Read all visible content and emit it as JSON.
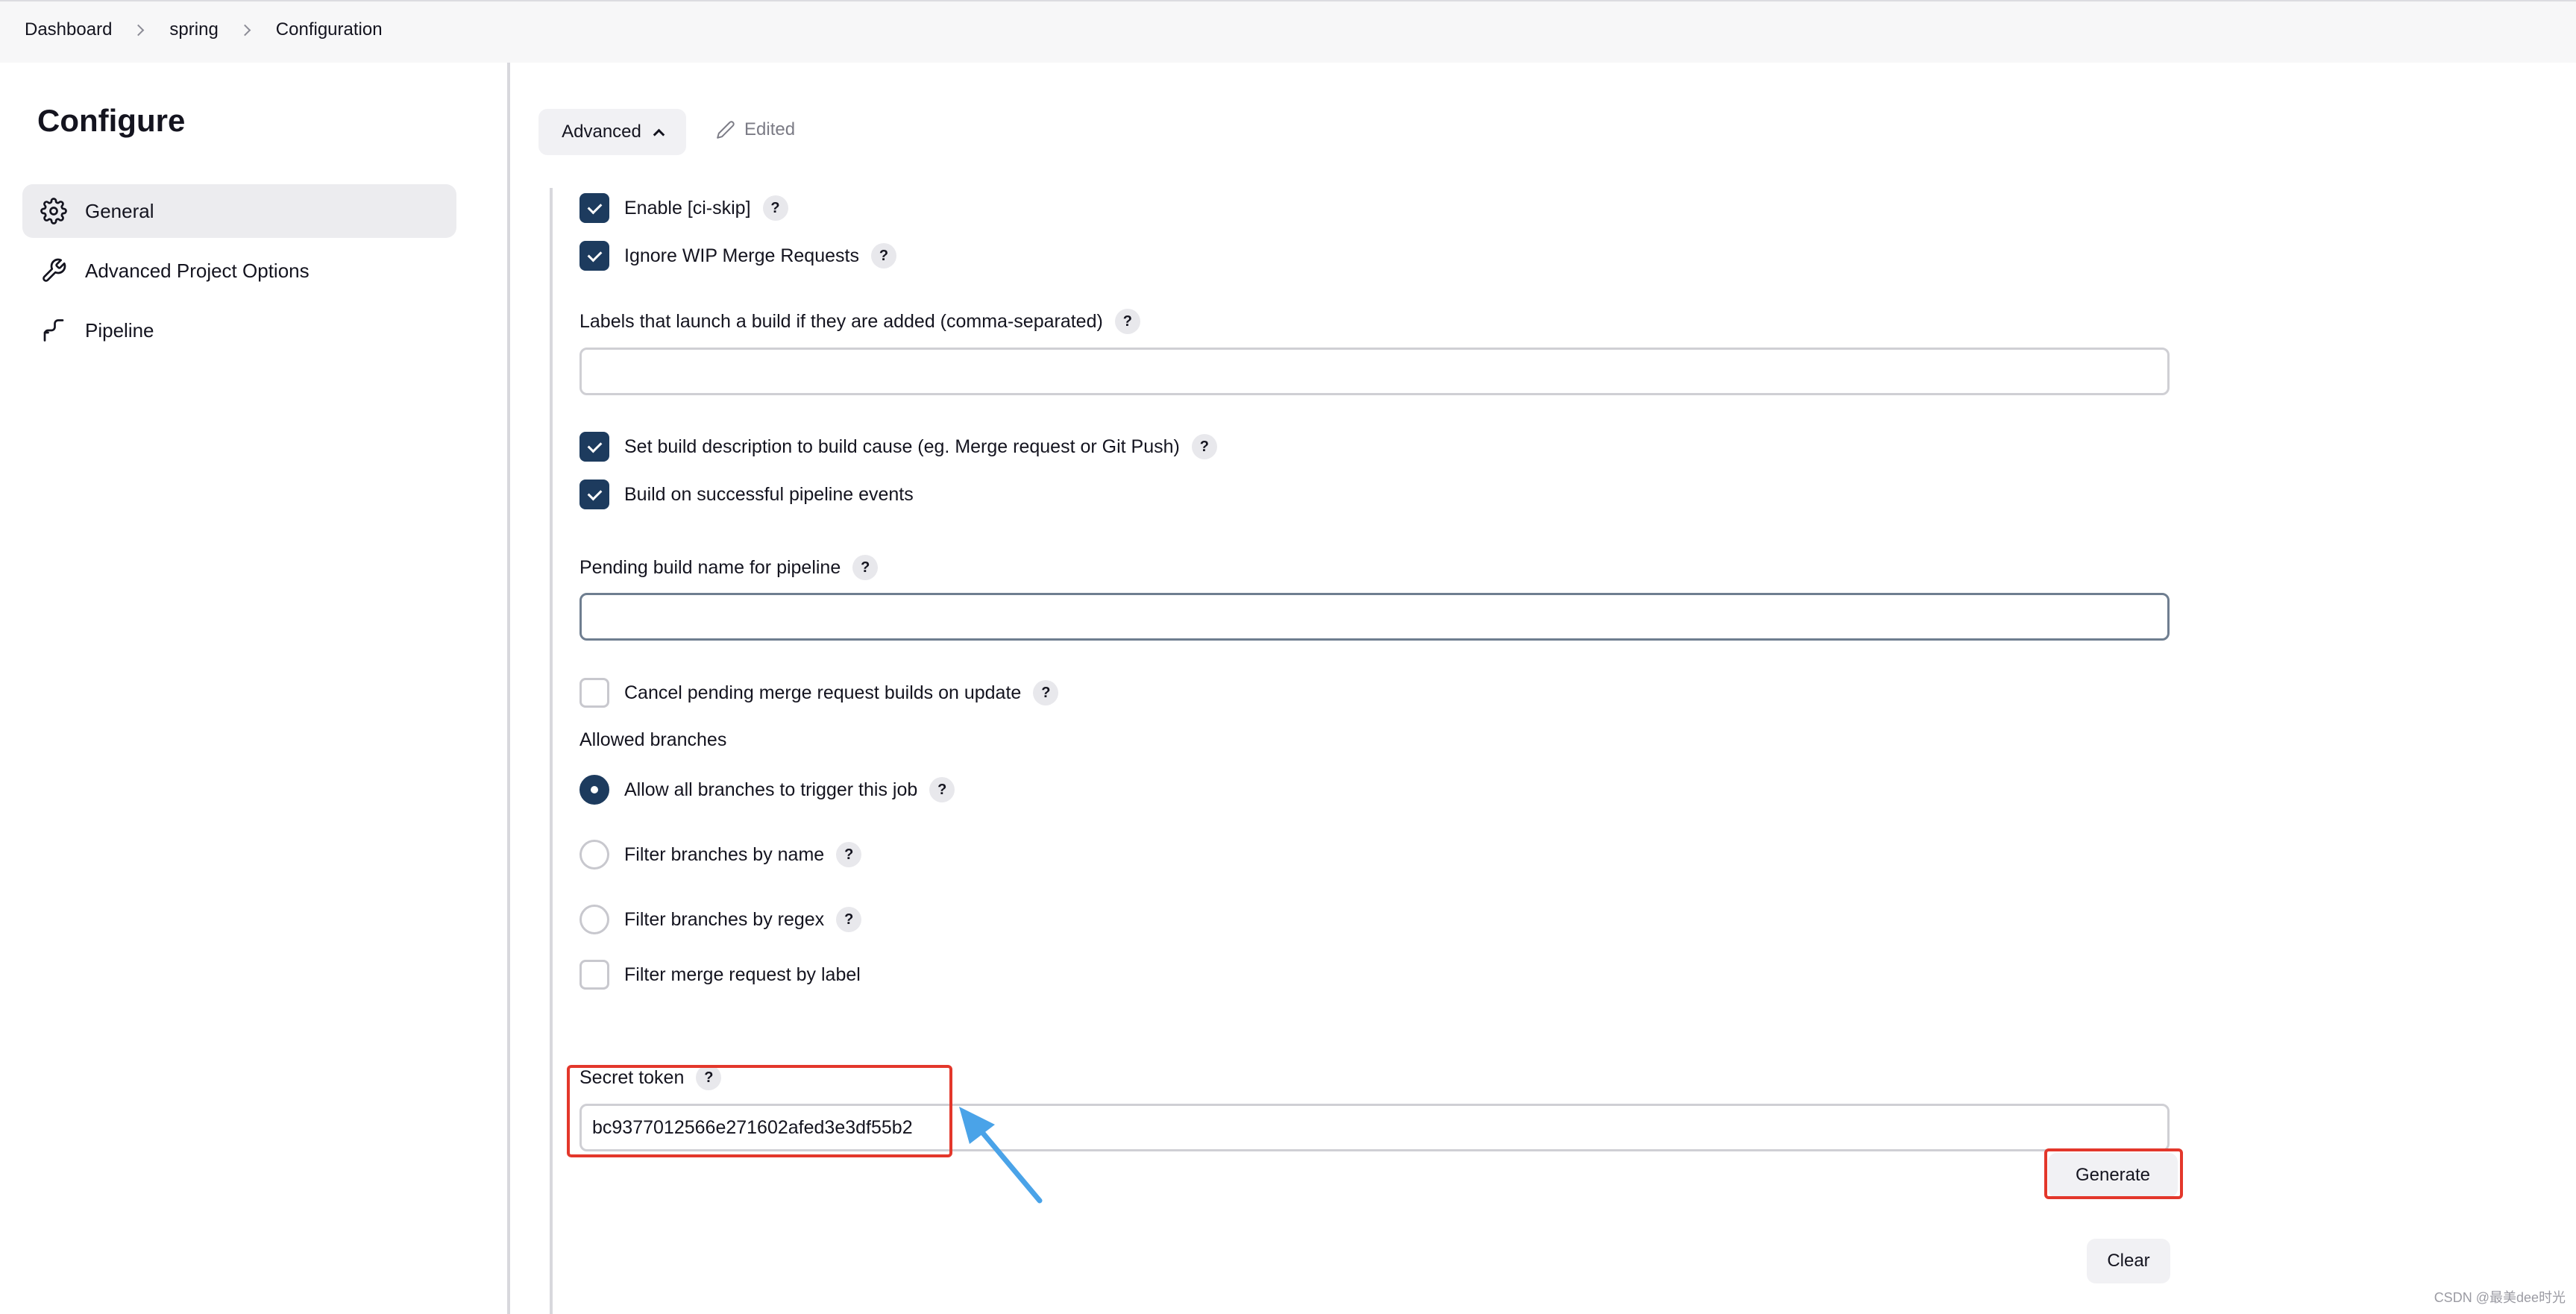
{
  "breadcrumb": {
    "items": [
      "Dashboard",
      "spring",
      "Configuration"
    ]
  },
  "sidebar": {
    "title": "Configure",
    "items": [
      {
        "label": "General",
        "icon": "gear-icon",
        "active": true
      },
      {
        "label": "Advanced Project Options",
        "icon": "wrench-icon",
        "active": false
      },
      {
        "label": "Pipeline",
        "icon": "pipeline-icon",
        "active": false
      }
    ]
  },
  "main": {
    "advanced_button": "Advanced",
    "edited_label": "Edited",
    "options": {
      "ci_skip": {
        "label": "Enable [ci-skip]",
        "checked": true
      },
      "ignore_wip": {
        "label": "Ignore WIP Merge Requests",
        "checked": true
      },
      "labels_field": {
        "label": "Labels that launch a build if they are added (comma-separated)",
        "value": ""
      },
      "set_build_description": {
        "label": "Set build description to build cause (eg. Merge request or Git Push)",
        "checked": true
      },
      "build_on_pipeline": {
        "label": "Build on successful pipeline events",
        "checked": true
      },
      "pending_build_name": {
        "label": "Pending build name for pipeline",
        "value": ""
      },
      "cancel_pending": {
        "label": "Cancel pending merge request builds on update",
        "checked": false
      }
    },
    "allowed_branches": {
      "title": "Allowed branches",
      "choices": [
        {
          "label": "Allow all branches to trigger this job",
          "selected": true
        },
        {
          "label": "Filter branches by name",
          "selected": false
        },
        {
          "label": "Filter branches by regex",
          "selected": false
        }
      ],
      "filter_by_label": {
        "label": "Filter merge request by label",
        "checked": false
      }
    },
    "secret_token": {
      "label": "Secret token",
      "value": "bc9377012566e271602afed3e3df55b2",
      "generate_button": "Generate",
      "clear_button": "Clear"
    },
    "help_mark": "?"
  },
  "watermark": "CSDN @最美dee时光",
  "colors": {
    "accent": "#1d3b5e",
    "annotation_red": "#e3372b",
    "annotation_arrow": "#4aa3e8",
    "topbar": "#f7f7f8"
  }
}
